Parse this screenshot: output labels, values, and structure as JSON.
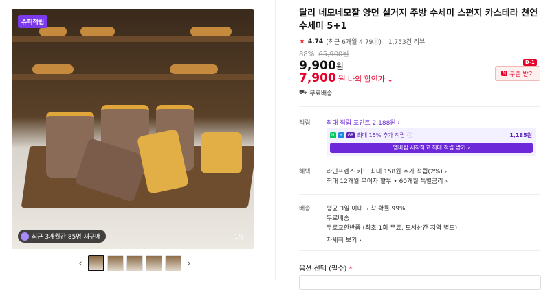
{
  "gallery": {
    "badge": "슈퍼적립",
    "restock": "최근 3개월간 85명 재구매",
    "pager": "1/8"
  },
  "product": {
    "title": "달리 네모네모잘 양면 설거지 주방 수세미 스펀지 카스테라 천연 수세미 5+1",
    "rating": "4.74",
    "rating_recent": "(최근 6개월 4.79",
    "reviews": "1,753건 리뷰",
    "discount_pct": "88%",
    "original_price": "65,900원",
    "price": "9,900",
    "price_unit": "원",
    "sale_price": "7,900",
    "sale_unit": "원",
    "my_discount": "나의 할인가",
    "coupon_label": "쿠폰 받기",
    "coupon_n": "N",
    "dday": "D-1",
    "shipping_free": "무료배송"
  },
  "benefits": {
    "points_label": "적립",
    "points_text": "최대 적립 포인트 2,188원",
    "box_text": "최대 15% 추가 적립",
    "box_amount": "1,185원",
    "box_cta": "멤버십 시작하고 최대 적립 받기",
    "chips": [
      "N",
      "+",
      "GR"
    ],
    "chip_colors": [
      "#03c75a",
      "#1e88e5",
      "#5b21b6"
    ],
    "perk_label": "혜택",
    "perk1": "라인프렌즈 카드 최대 158원 추가 적립(2%)",
    "perk2": "최대 12개월 무이자 할부 • 60개월 특별금리"
  },
  "delivery": {
    "label": "배송",
    "line1": "평균 3일 이내 도착 확률 99%",
    "line2": "무료배송",
    "line3": "무료교환반품 (최초 1회 무료, 도서산간 지역 별도)",
    "more": "자세히 보기"
  },
  "options": {
    "label": "옵션 선택 (필수)",
    "required_mark": "*"
  }
}
